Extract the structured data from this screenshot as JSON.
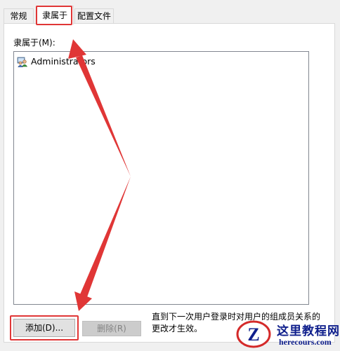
{
  "tabs": [
    {
      "label": "常规"
    },
    {
      "label": "隶属于"
    },
    {
      "label": "配置文件"
    }
  ],
  "member_of_label": "隶属于(M):",
  "list": {
    "items": [
      {
        "name": "Administrators",
        "icon": "user-group-icon"
      }
    ]
  },
  "buttons": {
    "add_label": "添加(D)...",
    "remove_label": "删除(R)"
  },
  "note_text": "直到下一次用户登录时对用户的组成员关系的更改才生效。",
  "watermark": {
    "title": "这里教程网",
    "url": "herecours.com",
    "logo_letter": "Z"
  },
  "colors": {
    "annotation_red": "#e03636",
    "watermark_blue": "#0f1f8c"
  }
}
